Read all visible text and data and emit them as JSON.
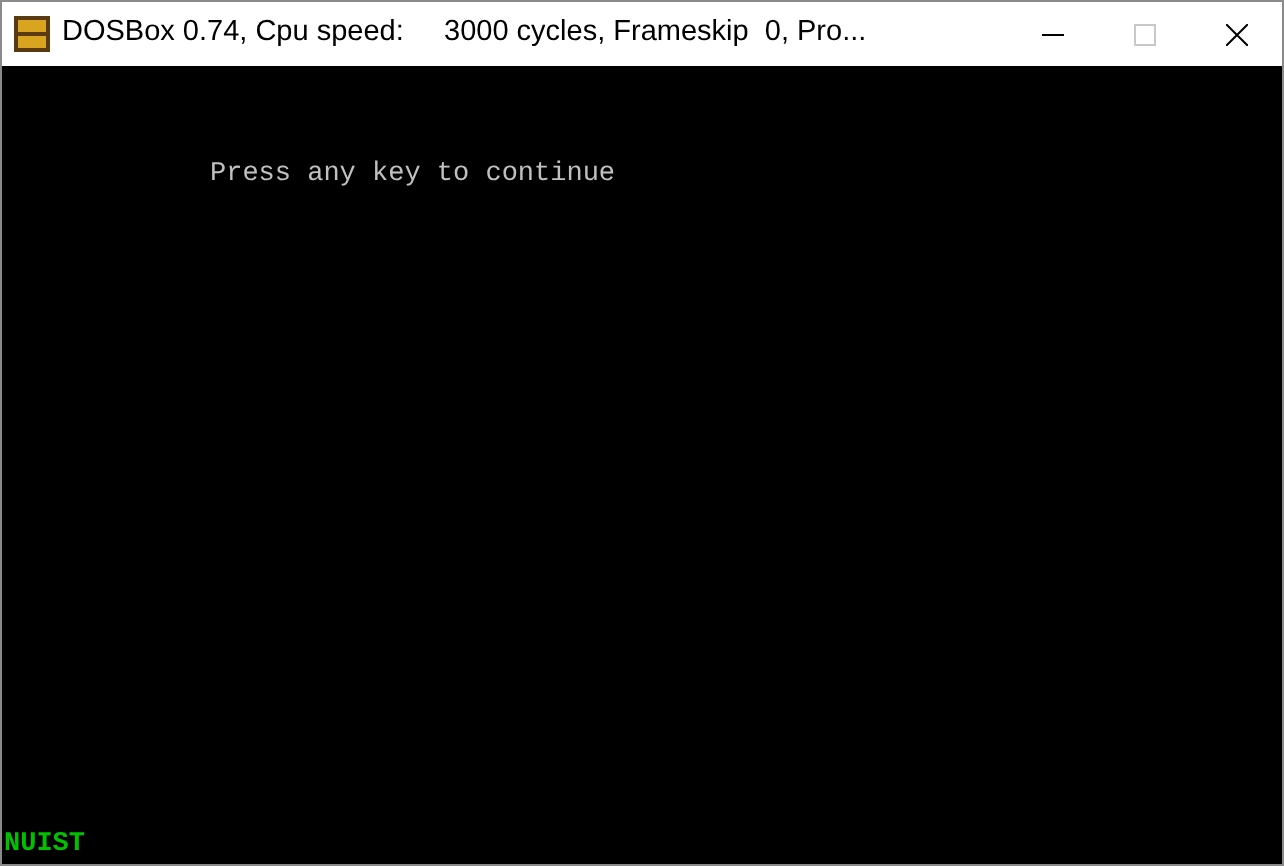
{
  "window": {
    "title": "DOSBox 0.74, Cpu speed:     3000 cycles, Frameskip  0, Pro...",
    "maximize_disabled": true
  },
  "screen": {
    "lines": [
      {
        "text": "Press any key to continue",
        "color": "#c0c0c0"
      }
    ],
    "footer": {
      "text": "NUIST",
      "color": "#00c000"
    }
  }
}
